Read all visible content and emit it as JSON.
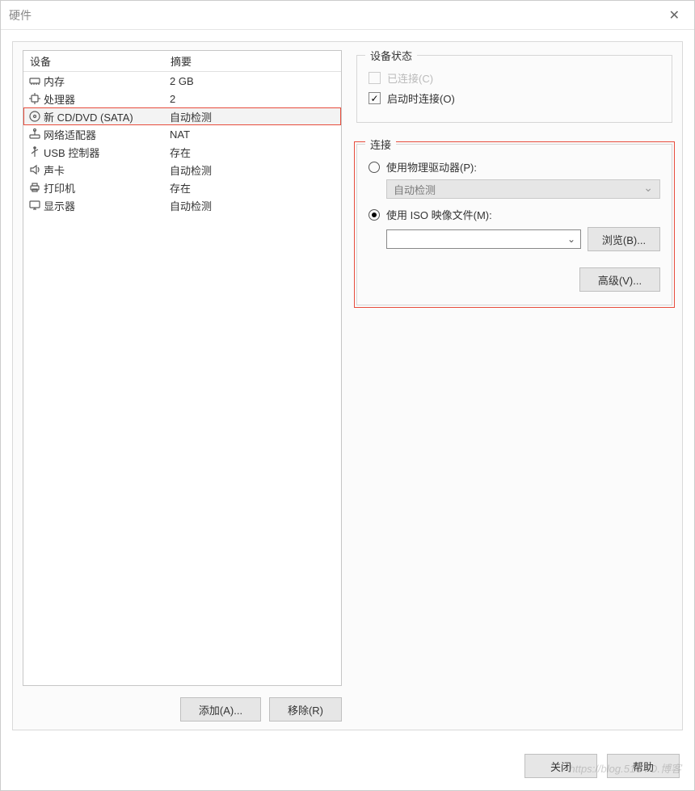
{
  "window": {
    "title": "硬件"
  },
  "device_table": {
    "header_device": "设备",
    "header_summary": "摘要",
    "rows": [
      {
        "icon": "memory",
        "name": "内存",
        "summary": "2 GB",
        "selected": false
      },
      {
        "icon": "cpu",
        "name": "处理器",
        "summary": "2",
        "selected": false
      },
      {
        "icon": "disc",
        "name": "新 CD/DVD (SATA)",
        "summary": "自动检测",
        "selected": true
      },
      {
        "icon": "network",
        "name": "网络适配器",
        "summary": "NAT",
        "selected": false
      },
      {
        "icon": "usb",
        "name": "USB 控制器",
        "summary": "存在",
        "selected": false
      },
      {
        "icon": "sound",
        "name": "声卡",
        "summary": "自动检测",
        "selected": false
      },
      {
        "icon": "printer",
        "name": "打印机",
        "summary": "存在",
        "selected": false
      },
      {
        "icon": "monitor",
        "name": "显示器",
        "summary": "自动检测",
        "selected": false
      }
    ]
  },
  "left_buttons": {
    "add": "添加(A)...",
    "remove": "移除(R)"
  },
  "device_status": {
    "legend": "设备状态",
    "connected_label": "已连接(C)",
    "connected_checked": false,
    "connected_enabled": false,
    "connect_at_power_on_label": "启动时连接(O)",
    "connect_at_power_on_checked": true
  },
  "connection": {
    "legend": "连接",
    "physical_label": "使用物理驱动器(P):",
    "physical_selected": false,
    "physical_dropdown_value": "自动检测",
    "iso_label": "使用 ISO 映像文件(M):",
    "iso_selected": true,
    "iso_path": "",
    "browse_btn": "浏览(B)...",
    "advanced_btn": "高级(V)..."
  },
  "footer": {
    "close": "关闭",
    "help": "帮助"
  },
  "watermark": "https://blog.51CTO.博客"
}
